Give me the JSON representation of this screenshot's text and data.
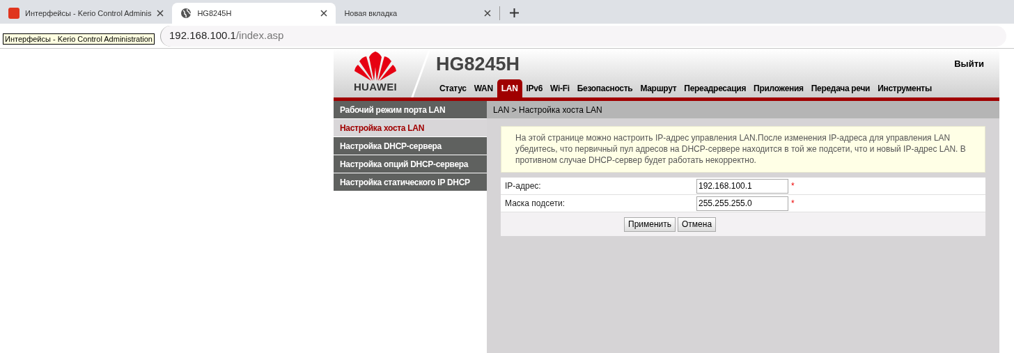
{
  "browser": {
    "tabs": [
      {
        "title": "Интерфейсы - Kerio Control Adminis",
        "selected": false,
        "kind": "kerio"
      },
      {
        "title": "HG8245H",
        "selected": true,
        "kind": "globe"
      },
      {
        "title": "Новая вкладка",
        "selected": false,
        "kind": "none"
      }
    ],
    "tooltip": "Интерфейсы - Kerio Control Administration",
    "address_host": "192.168.100.1",
    "address_path": "/index.asp"
  },
  "router": {
    "model": "HG8245H",
    "brand": "HUAWEI",
    "logout": "Выйти",
    "nav": [
      {
        "label": "Статус",
        "selected": false
      },
      {
        "label": "WAN",
        "selected": false
      },
      {
        "label": "LAN",
        "selected": true
      },
      {
        "label": "IPv6",
        "selected": false
      },
      {
        "label": "Wi-Fi",
        "selected": false
      },
      {
        "label": "Безопасность",
        "selected": false
      },
      {
        "label": "Маршрут",
        "selected": false
      },
      {
        "label": "Переадресация",
        "selected": false
      },
      {
        "label": "Приложения",
        "selected": false
      },
      {
        "label": "Передача речи",
        "selected": false
      },
      {
        "label": "Инструменты",
        "selected": false
      }
    ],
    "sidebar": [
      {
        "label": "Рабочий режим порта LAN",
        "selected": false
      },
      {
        "label": "Настройка хоста LAN",
        "selected": true
      },
      {
        "label": "Настройка DHCP-сервера",
        "selected": false
      },
      {
        "label": "Настройка опций DHCP-сервера",
        "selected": false
      },
      {
        "label": "Настройка статического IP DHCP",
        "selected": false
      }
    ],
    "breadcrumb": "LAN > Настройка хоста LAN",
    "notice": "На этой странице можно настроить IP-адрес управления LAN.После изменения IP-адреса для управления LAN убедитесь, что первичный пул адресов на DHCP-сервере находится в той же подсети, что и новый IP-адрес LAN. В противном случае DHCP-сервер будет работать некорректно.",
    "fields": [
      {
        "label": "IP-адрес:",
        "value": "192.168.100.1",
        "required": "*"
      },
      {
        "label": "Маска подсети:",
        "value": "255.255.255.0",
        "required": "*"
      }
    ],
    "buttons": [
      "Применить",
      "Отмена"
    ]
  }
}
